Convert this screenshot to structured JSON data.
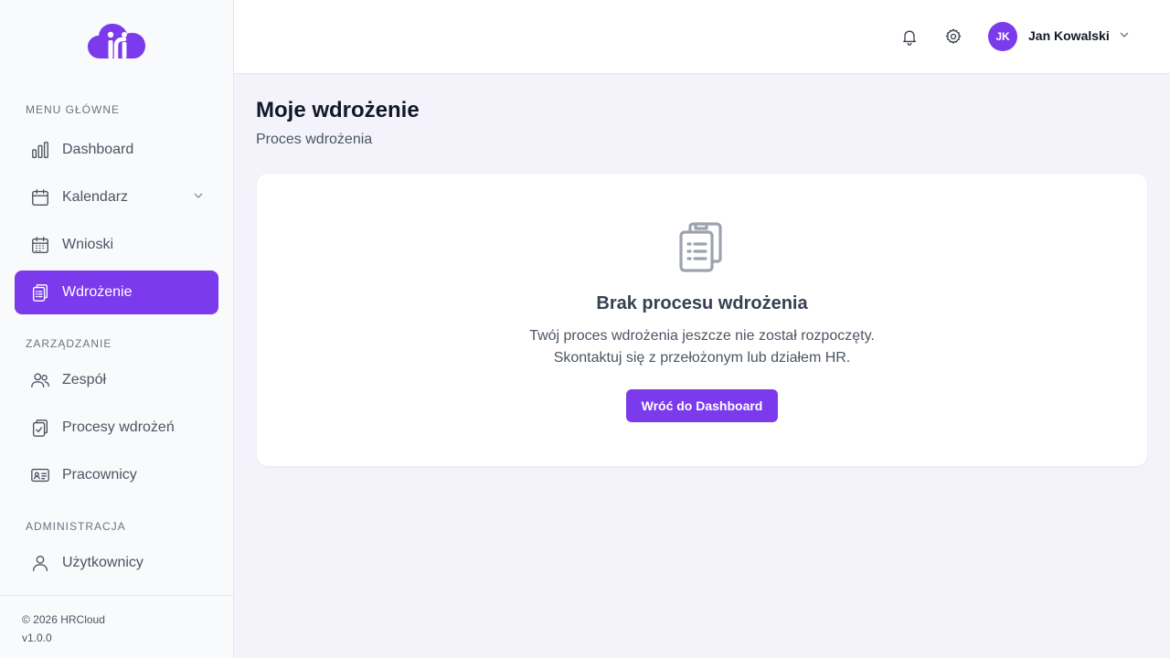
{
  "sidebar": {
    "logo_alt": "HRCloud",
    "sections": {
      "main": "MENU GŁÓWNE",
      "management": "ZARZĄDZANIE",
      "admin": "ADMINISTRACJA"
    },
    "items": {
      "dashboard": "Dashboard",
      "calendar": "Kalendarz",
      "requests": "Wnioski",
      "onboarding": "Wdrożenie",
      "team": "Zespół",
      "onboarding_processes": "Procesy wdrożeń",
      "employees": "Pracownicy",
      "users": "Użytkownicy"
    },
    "active_item": "Wdrożenie",
    "footer": {
      "copyright": "© 2026 HRCloud",
      "version": "v1.0.0"
    }
  },
  "header": {
    "icons": [
      "bell-icon",
      "gear-icon"
    ],
    "user": {
      "initials": "JK",
      "name": "Jan Kowalski"
    }
  },
  "main": {
    "title": "Moje wdrożenie",
    "subtitle": "Proces wdrożenia",
    "empty_state": {
      "icon": "clipboard-list-icon",
      "title": "Brak procesu wdrożenia",
      "line1": "Twój proces wdrożenia jeszcze nie został rozpoczęty.",
      "line2": "Skontaktuj się z przełożonym lub działem HR.",
      "button": "Wróć do Dashboard"
    }
  },
  "colors": {
    "accent": "#7c3aed",
    "background": "#f4f3fc",
    "sidebar_bg": "#f9fafb"
  }
}
